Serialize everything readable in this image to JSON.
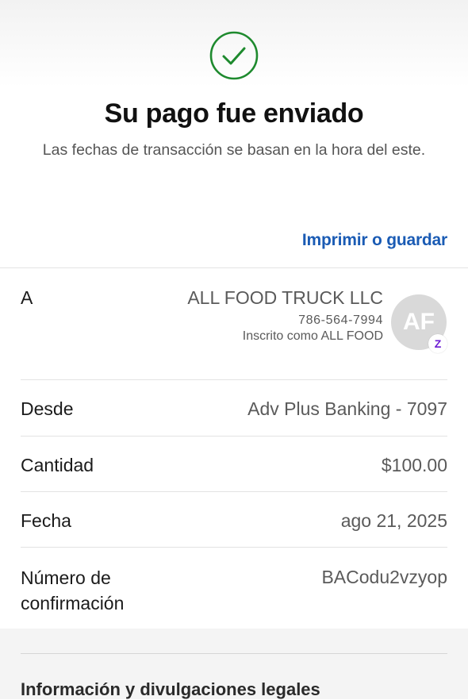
{
  "header": {
    "title": "Su pago fue enviado",
    "subtitle": "Las fechas de transacción se basan en la hora del este.",
    "success_icon": "check-circle-icon",
    "success_color": "#1e8a2e"
  },
  "actions": {
    "print_save_label": "Imprimir o guardar",
    "link_color": "#1a5bb4"
  },
  "details": {
    "to": {
      "label": "A",
      "name": "ALL FOOD TRUCK LLC",
      "phone": "786-564-7994",
      "enrolled": "Inscrito como ALL FOOD",
      "avatar_initials": "AF",
      "badge_icon": "zelle-icon",
      "badge_glyph": "Z"
    },
    "from": {
      "label": "Desde",
      "value": "Adv Plus Banking - 7097"
    },
    "amount": {
      "label": "Cantidad",
      "value": "$100.00"
    },
    "date": {
      "label": "Fecha",
      "value": "ago 21, 2025"
    },
    "confirmation": {
      "label": "Número de confirmación",
      "value": "BACodu2vzyop"
    }
  },
  "footer": {
    "legal_title": "Información y divulgaciones legales"
  }
}
